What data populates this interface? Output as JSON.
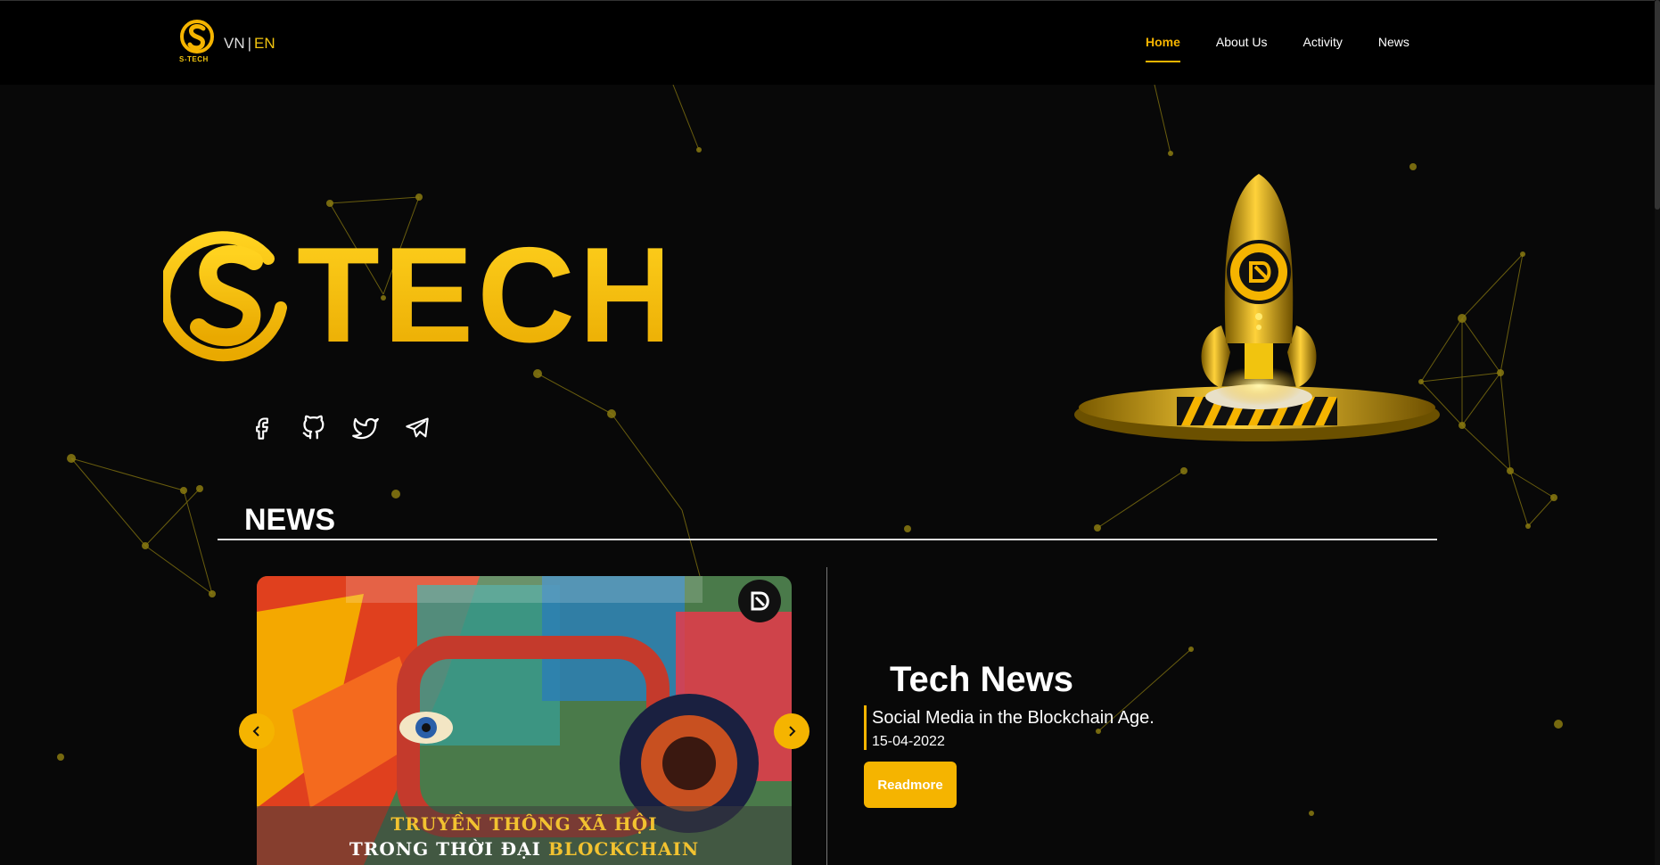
{
  "brand": {
    "small_caption": "S-TECH",
    "hero_text": "TECH",
    "accent_color": "#f5b400"
  },
  "lang": {
    "vn": "VN",
    "separator": "|",
    "en": "EN"
  },
  "nav": {
    "items": [
      {
        "label": "Home",
        "active": true
      },
      {
        "label": "About Us",
        "active": false
      },
      {
        "label": "Activity",
        "active": false
      },
      {
        "label": "News",
        "active": false
      }
    ]
  },
  "socials": [
    "facebook-icon",
    "github-icon",
    "twitter-icon",
    "telegram-icon"
  ],
  "news": {
    "section_title": "NEWS",
    "card": {
      "caption_line1": "TRUYỀN THÔNG XÃ HỘI",
      "caption_line2_prefix": "TRONG THỜI ĐẠI ",
      "caption_line2_highlight": "BLOCKCHAIN"
    },
    "detail": {
      "heading": "Tech News",
      "title": "Social Media in the Blockchain Age.",
      "date": "15-04-2022",
      "button": "Readmore"
    }
  }
}
